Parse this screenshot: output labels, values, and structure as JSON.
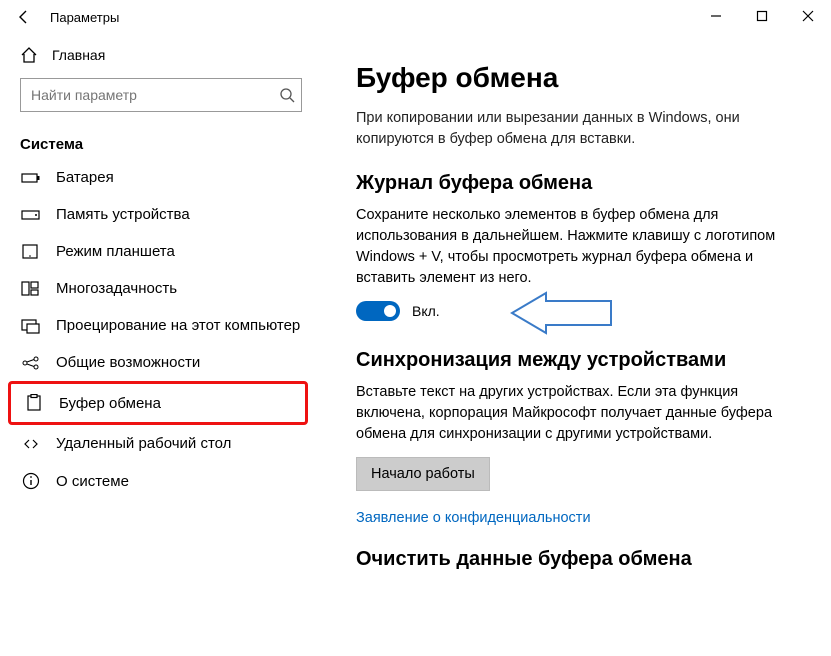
{
  "titlebar": {
    "title": "Параметры"
  },
  "sidebar": {
    "home": "Главная",
    "search_placeholder": "Найти параметр",
    "section": "Система",
    "items": [
      {
        "label": "Батарея"
      },
      {
        "label": "Память устройства"
      },
      {
        "label": "Режим планшета"
      },
      {
        "label": "Многозадачность"
      },
      {
        "label": "Проецирование на этот компьютер"
      },
      {
        "label": "Общие возможности"
      },
      {
        "label": "Буфер обмена"
      },
      {
        "label": "Удаленный рабочий стол"
      },
      {
        "label": "О системе"
      }
    ]
  },
  "main": {
    "title": "Буфер обмена",
    "intro": "При копировании или вырезании данных в Windows, они копируются в буфер обмена для вставки.",
    "history": {
      "heading": "Журнал буфера обмена",
      "body": "Сохраните несколько элементов в буфер обмена для использования в дальнейшем. Нажмите клавишу с логотипом Windows + V, чтобы просмотреть журнал буфера обмена и вставить элемент из него.",
      "toggle_label": "Вкл."
    },
    "sync": {
      "heading": "Синхронизация между устройствами",
      "body": "Вставьте текст на других устройствах. Если эта функция включена, корпорация Майкрософт получает данные буфера обмена для синхронизации с другими устройствами.",
      "button": "Начало работы"
    },
    "privacy_link": "Заявление о конфиденциальности",
    "clear": {
      "heading": "Очистить данные буфера обмена"
    }
  }
}
